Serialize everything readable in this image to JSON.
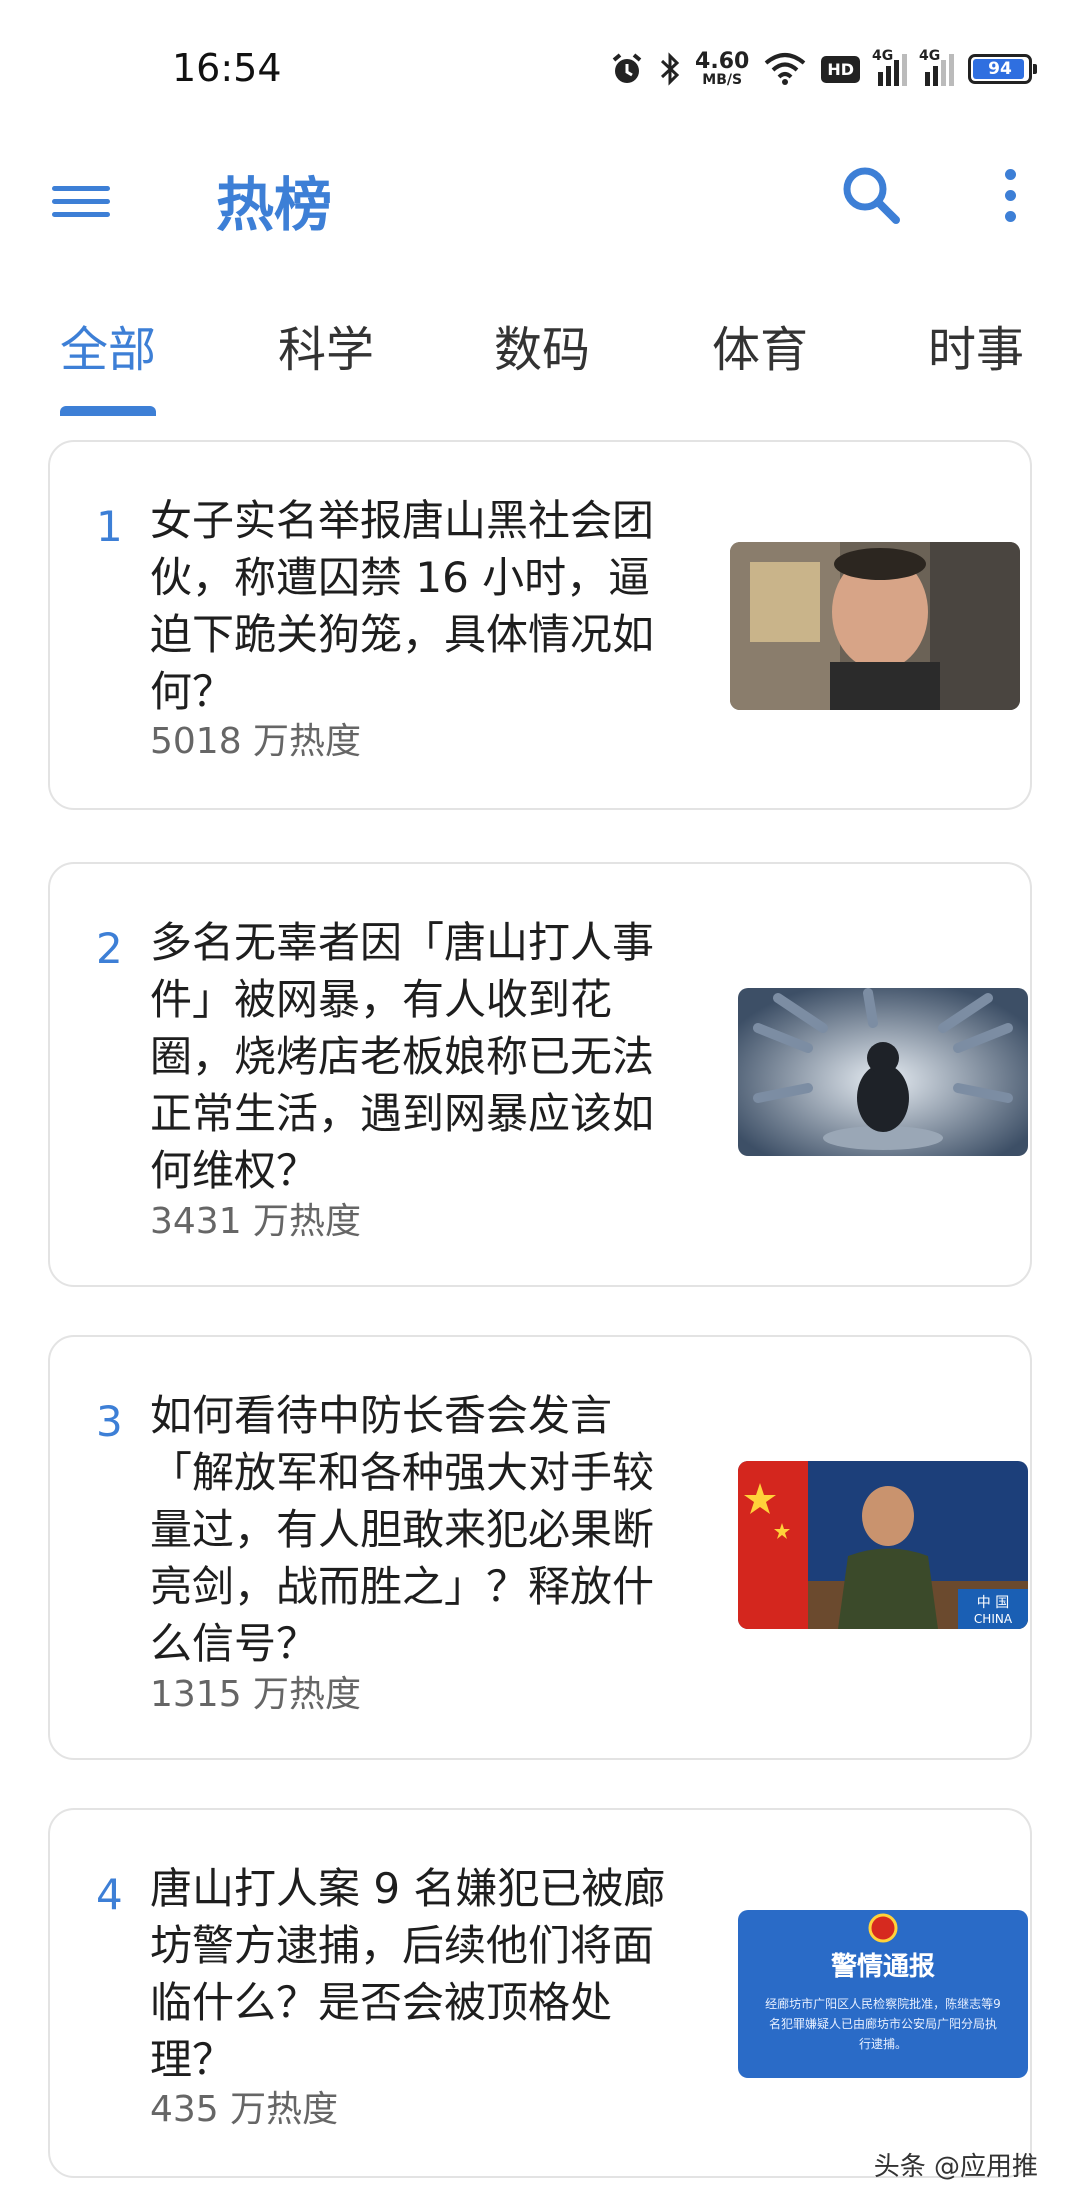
{
  "status_bar": {
    "time": "16:54",
    "net_speed": "4.60",
    "net_speed_unit": "MB/S",
    "hd_label": "HD",
    "sim1_label": "4G",
    "sim2_label": "4G",
    "battery": "94",
    "icons": [
      "alarm-icon",
      "bluetooth-icon",
      "wifi-icon",
      "signal-icon",
      "battery-icon"
    ]
  },
  "app_bar": {
    "title": "热榜",
    "icons": [
      "menu-icon",
      "search-icon",
      "more-vert-icon"
    ]
  },
  "tabs": [
    {
      "label": "全部",
      "active": true
    },
    {
      "label": "科学"
    },
    {
      "label": "数码"
    },
    {
      "label": "体育"
    },
    {
      "label": "时事"
    }
  ],
  "items": [
    {
      "rank": "1",
      "title": "女子实名举报唐山黑社会团伙，称遭囚禁 16 小时，逼迫下跪关狗笼，具体情况如何？",
      "heat": "5018 万热度",
      "thumb": "photo-man-portrait"
    },
    {
      "rank": "2",
      "title": "多名无辜者因「唐山打人事件」被网暴，有人收到花圈，烧烤店老板娘称已无法正常生活，遇到网暴应该如何维权？",
      "heat": "3431 万热度",
      "thumb": "illustration-cyberbullying"
    },
    {
      "rank": "3",
      "title": "如何看待中防长香会发言「解放军和各种强大对手较量过，有人胆敢来犯必果断亮剑，战而胜之」？释放什么信号？",
      "heat": "1315 万热度",
      "thumb": "photo-official-speech",
      "thumb_badge": {
        "line1": "中 国",
        "line2": "CHINA"
      }
    },
    {
      "rank": "4",
      "title": "唐山打人案 9 名嫌犯已被廊坊警方逮捕，后续他们将面临什么？是否会被顶格处理？",
      "heat": "435 万热度",
      "thumb": "police-notice-card",
      "thumb_title": "警情通报",
      "thumb_text": "经廊坊市广阳区人民检察院批准，陈继志等9名犯罪嫌疑人已由廊坊市公安局广阳分局执行逮捕。"
    }
  ],
  "watermark": "头条 @应用推",
  "colors": {
    "accent": "#3d7fd6",
    "text": "#1e1e1e",
    "muted": "#666666",
    "border": "#e3e3e3"
  }
}
